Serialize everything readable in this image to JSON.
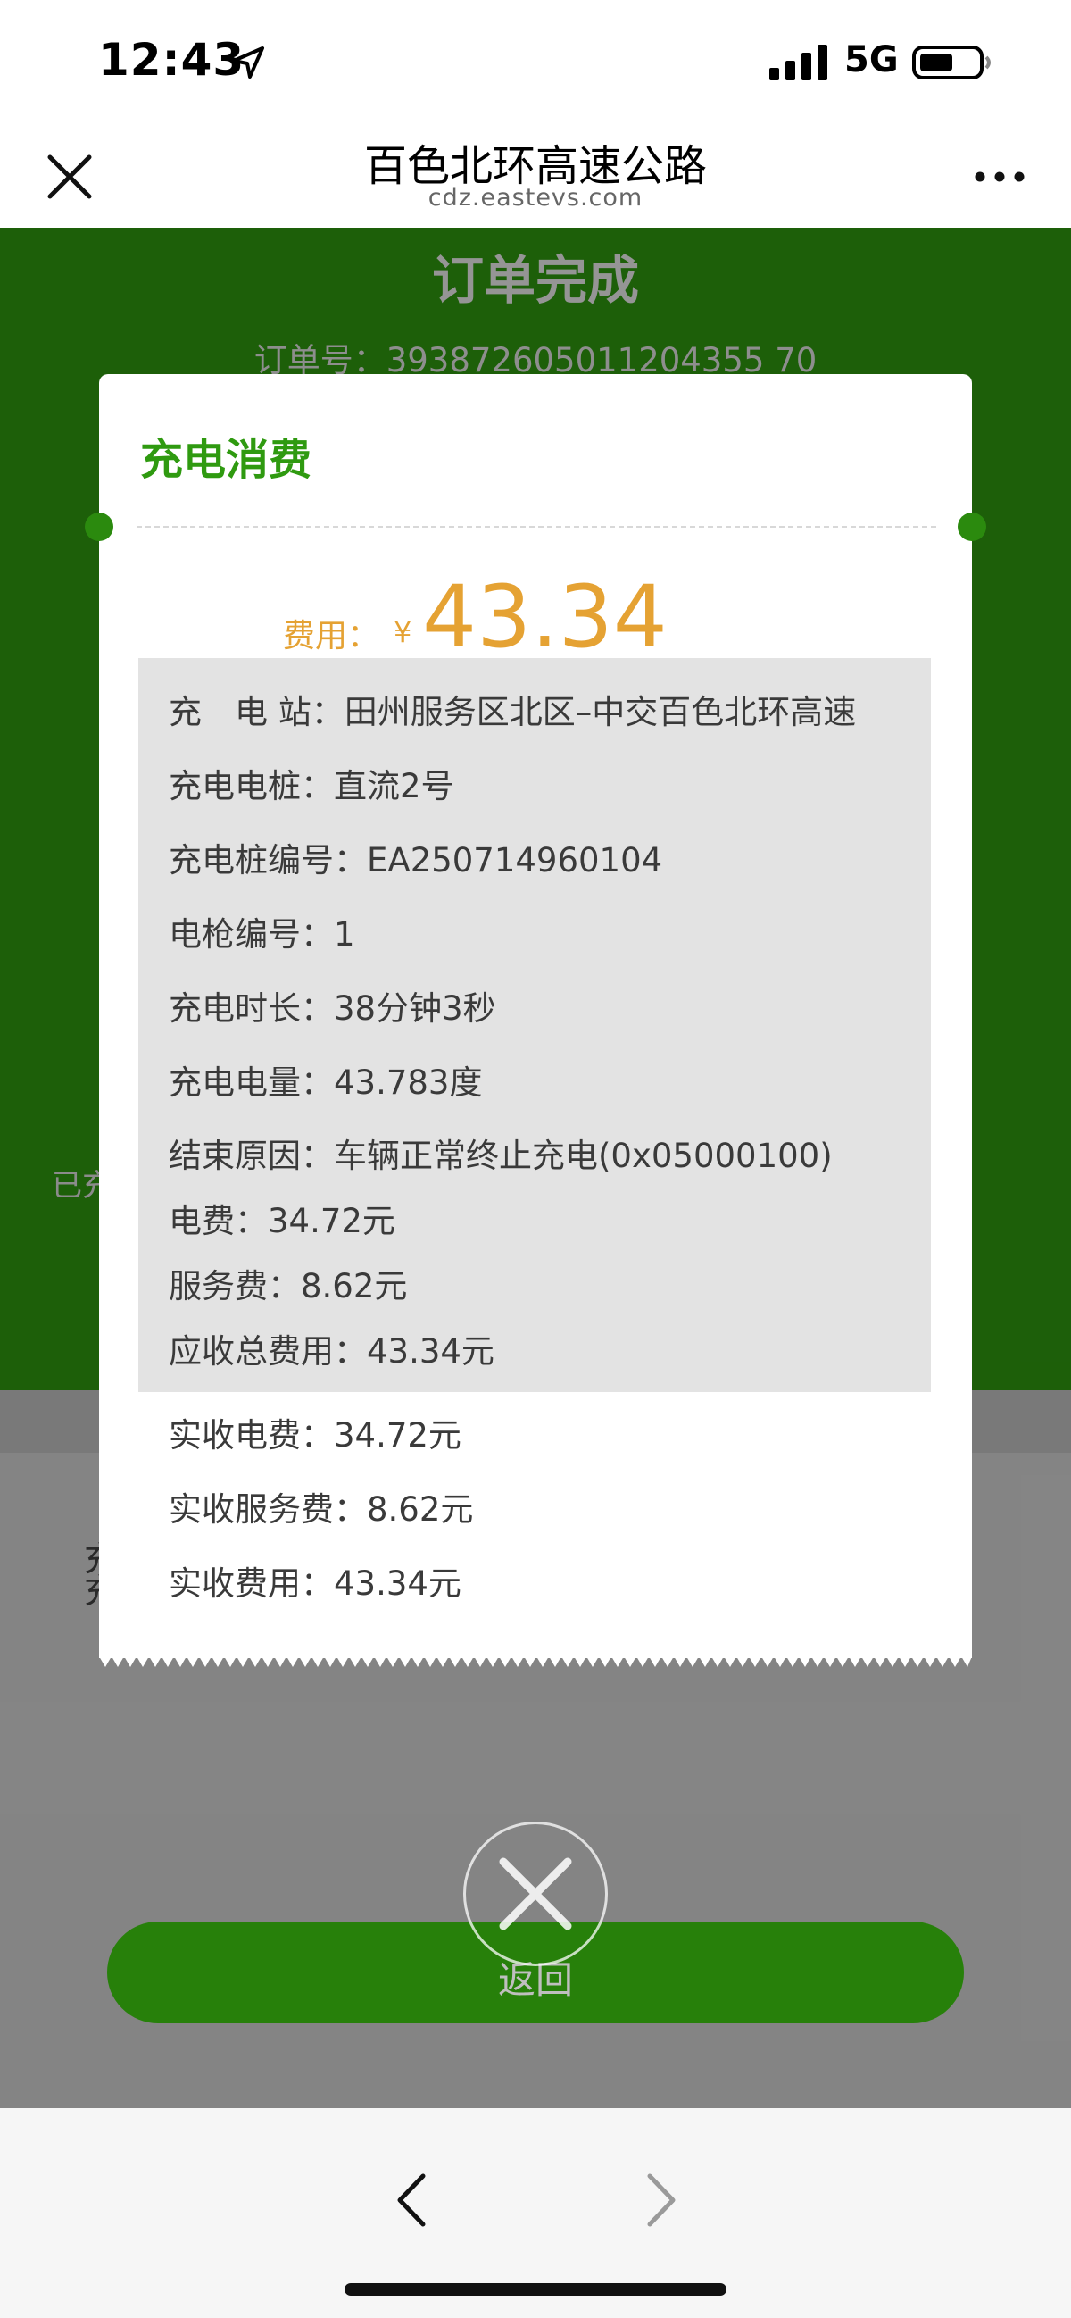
{
  "status_bar": {
    "time": "12:43",
    "network": "5G",
    "icons": [
      "location-arrow-icon",
      "signal-icon",
      "battery-icon"
    ]
  },
  "nav": {
    "title": "百色北环高速公路",
    "url": "cdz.eastevs.com",
    "icons": [
      "close-icon",
      "more-icon"
    ]
  },
  "page": {
    "title": "订单完成",
    "order_label": "订单号：",
    "order_number": "393872605011204355 70",
    "charged_fragment": "已充",
    "row_fragment_1": "充",
    "row_fragment_2": "充",
    "return_button": "返回"
  },
  "receipt": {
    "title": "充电消费",
    "fee_label": "费用：",
    "currency": "¥",
    "fee_amount": "43.34",
    "details": [
      "充　电 站：田州服务区北区–中交百色北环高速",
      "充电电桩：直流2号",
      "充电桩编号：EA250714960104",
      "电枪编号：1",
      "充电时长：38分钟3秒",
      "充电电量：43.783度",
      "结束原因：车辆正常终止充电(0x05000100)",
      "电费：34.72元",
      "服务费：8.62元",
      "应收总费用：43.34元"
    ],
    "paid": [
      "实收电费：34.72元",
      "实收服务费：8.62元",
      "实收费用：43.34元"
    ]
  },
  "colors": {
    "brand_green": "#2f9a10",
    "fee_orange": "#e5a233"
  }
}
